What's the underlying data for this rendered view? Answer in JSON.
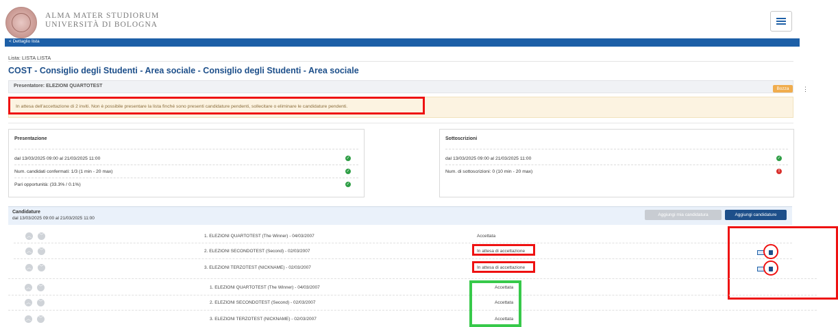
{
  "header": {
    "logo_line1": "ALMA MATER STUDIORUM",
    "logo_line2": "UNIVERSITÀ DI BOLOGNA",
    "menu_icon": "hamburger-icon"
  },
  "nav": {
    "back_label": "Dettaglio lista",
    "back_icon": "chevron-left-icon"
  },
  "list_label": "Lista: LISTA LISTA",
  "title": "COST - Consiglio degli Studenti - Area sociale - Consiglio degli Studenti - Area sociale",
  "badge": "Bozza",
  "presenter": "Presentatore:  ELEZIONI QUARTOTEST",
  "alert": "In attesa dell'accettazione di 2 inviti. Non è possibile presentare la lista finché sono presenti candidature pendenti, sollecitare o eliminare le candidature pendenti.",
  "presentazione": {
    "title": "Presentazione",
    "rows": [
      {
        "text": "dal 13/03/2025 09:00 al 21/03/2025 11:00"
      },
      {
        "text": "Num. candidati confermati: 1/3 (1 min - 20 max)"
      },
      {
        "text": "Pari opportunità: (33.3% / 0.1%)"
      }
    ]
  },
  "sottoscrizioni": {
    "title": "Sottoscrizioni",
    "rows": [
      {
        "text": "dal 13/03/2025 09:00 al 21/03/2025 11:00"
      },
      {
        "text": "Num. di sottoscrizioni: 0 (10 min - 20 max)"
      }
    ]
  },
  "candidature": {
    "title": "Candidature",
    "period": "dal 13/03/2025 09:00 al 21/03/2025 11:00",
    "btn_mine": "Aggiungi mia candidatura",
    "btn_add": "Aggiungi candidature",
    "rows": [
      {
        "name": "1. ELEZIONI QUARTOTEST (The Winner) - 04/03/2007",
        "status": "Accettata"
      },
      {
        "name": "2. ELEZIONI SECONDOTEST (Second) - 02/03/2007",
        "status": "In attesa di accettazione"
      },
      {
        "name": "3. ELEZIONI TERZOTEST (NICKNAME) - 02/03/2007",
        "status": "In attesa di accettazione"
      }
    ],
    "rows_after": [
      {
        "name": "1. ELEZIONI QUARTOTEST (The Winner) - 04/03/2007",
        "status": "Accettata"
      },
      {
        "name": "2. ELEZIONI SECONDOTEST (Second) - 02/03/2007",
        "status": "Accettata"
      },
      {
        "name": "3. ELEZIONI TERZOTEST (NICKNAME) - 02/03/2007",
        "status": "Accettata"
      }
    ]
  },
  "icons": {
    "ok": "check-circle-icon",
    "error": "exclamation-circle-icon",
    "up": "chevron-up-icon",
    "down": "chevron-down-icon",
    "mail": "mail-icon",
    "trash": "trash-icon"
  },
  "symbols": {
    "ok": "✓",
    "err": "!",
    "up": "︿",
    "down": "﹀"
  },
  "colors": {
    "brand_blue": "#1d5fa7",
    "title_blue": "#1d4f8a",
    "success": "#2e9e45",
    "error": "#d9302c",
    "warning_badge": "#f0ad4e",
    "annotation_red": "#ee1111",
    "annotation_green": "#37c94a"
  }
}
